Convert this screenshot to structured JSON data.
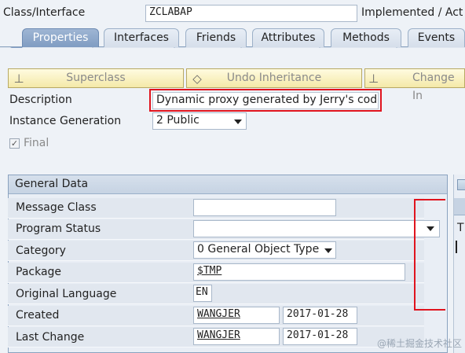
{
  "header": {
    "class_label": "Class/Interface",
    "class_value": "ZCLABAP",
    "status_text": "Implemented / Act"
  },
  "tabs": [
    {
      "label": "Properties",
      "active": true
    },
    {
      "label": "Interfaces",
      "active": false
    },
    {
      "label": "Friends",
      "active": false
    },
    {
      "label": "Attributes",
      "active": false
    },
    {
      "label": "Methods",
      "active": false
    },
    {
      "label": "Events",
      "active": false
    }
  ],
  "toolbar": {
    "superclass": "Superclass",
    "undo_inheritance": "Undo Inheritance",
    "change": "Change In"
  },
  "props": {
    "description_label": "Description",
    "description_value": "Dynamic proxy generated by Jerry's code",
    "instance_label": "Instance Generation",
    "instance_value": "2 Public",
    "final_label": "Final"
  },
  "general": {
    "title": "General Data",
    "message_class_label": "Message Class",
    "message_class_value": "",
    "program_status_label": "Program Status",
    "program_status_value": "",
    "category_label": "Category",
    "category_value": "0 General Object Type",
    "package_label": "Package",
    "package_value": "$TMP",
    "orig_lang_label": "Original Language",
    "orig_lang_value": "EN",
    "created_label": "Created",
    "created_user": "WANGJER",
    "created_date": "2017-01-28",
    "last_change_label": "Last Change",
    "last_change_user": "WANGJER",
    "last_change_date": "2017-01-28"
  },
  "side": {
    "col_header": "T"
  },
  "watermark": "@稀土掘金技术社区",
  "colors": {
    "highlight": "#e0141e",
    "active_tab": "#7f9cc2",
    "button": "#f4e9a8"
  }
}
